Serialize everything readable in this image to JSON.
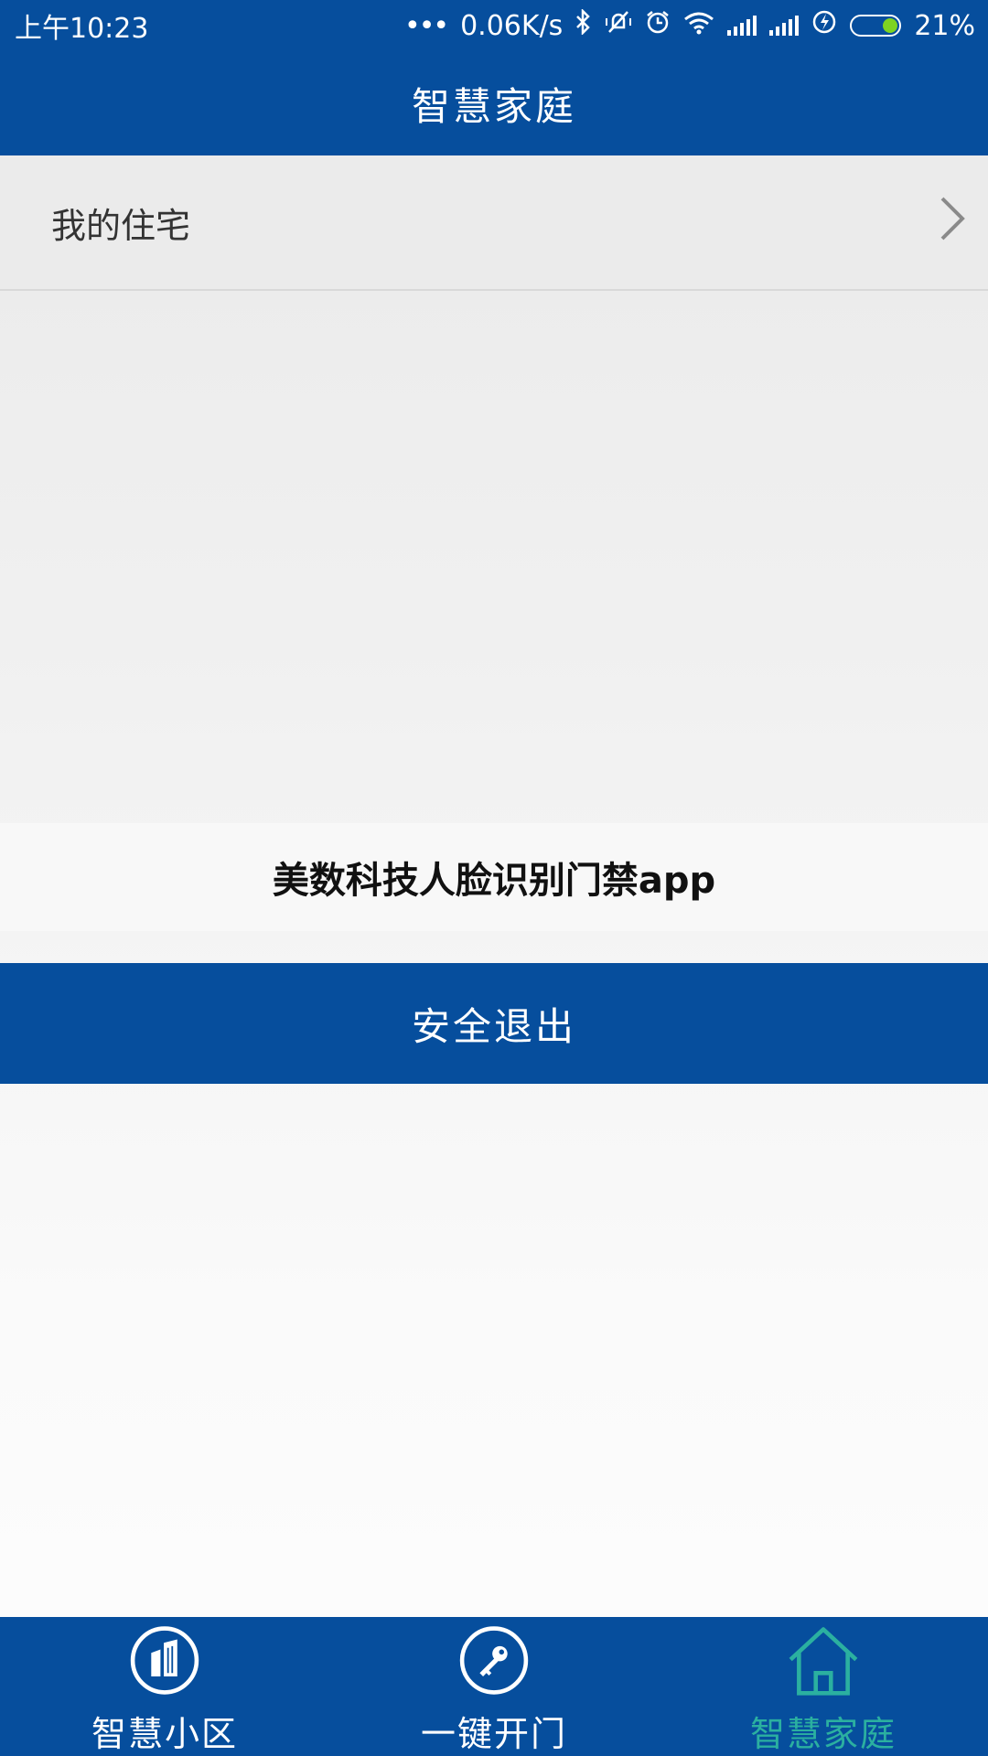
{
  "status_bar": {
    "time": "上午10:23",
    "network_speed": "0.06K/s",
    "battery_percent": "21%",
    "battery_level": 0.21,
    "icons": [
      "more-dots-icon",
      "bluetooth-icon",
      "mute-vibrate-icon",
      "alarm-icon",
      "wifi-icon",
      "signal-icon",
      "signal-icon",
      "charging-icon",
      "battery-icon"
    ]
  },
  "header": {
    "title": "智慧家庭"
  },
  "menu": {
    "my_residence_label": "我的住宅",
    "chevron_icon": "chevron-right-icon"
  },
  "watermark": {
    "text": "美数科技人脸识别门禁app"
  },
  "logout_button": {
    "label": "安全退出"
  },
  "bottom_nav": {
    "items": [
      {
        "label": "智慧小区",
        "icon": "building-icon",
        "active": false
      },
      {
        "label": "一键开门",
        "icon": "key-icon",
        "active": false
      },
      {
        "label": "智慧家庭",
        "icon": "home-icon",
        "active": true
      }
    ],
    "active_color": "#2bb0a0"
  },
  "colors": {
    "primary": "#064e9d",
    "background": "#efefef"
  }
}
